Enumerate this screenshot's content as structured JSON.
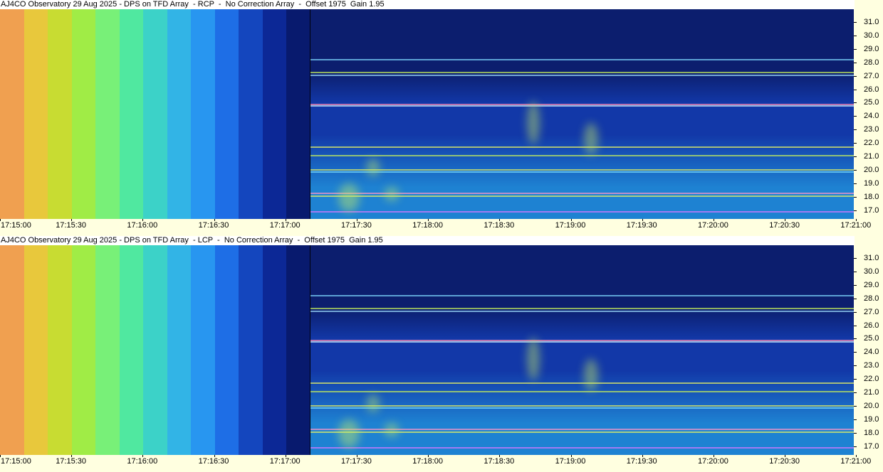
{
  "panels": [
    {
      "title": "AJ4CO Observatory 29 Aug 2025 - DPS on TFD Array  - RCP  -  No Correction Array  -  Offset 1975  Gain 1.95"
    },
    {
      "title": "AJ4CO Observatory 29 Aug 2025 - DPS on TFD Array  - LCP  -  No Correction Array  -  Offset 1975  Gain 1.95"
    }
  ],
  "frequency_axis": {
    "labels": [
      "31.0",
      "30.0",
      "29.0",
      "28.0",
      "27.0",
      "26.0",
      "25.0",
      "24.0",
      "23.0",
      "22.0",
      "21.0",
      "20.0",
      "19.0",
      "18.0",
      "17.0"
    ]
  },
  "time_axis": {
    "labels": [
      "17:15:00",
      "17:15:30",
      "17:16:00",
      "17:16:30",
      "17:17:00",
      "17:17:30",
      "17:18:00",
      "17:18:30",
      "17:19:00",
      "17:19:30",
      "17:20:00",
      "17:20:30",
      "17:21:00"
    ]
  },
  "calibration_colors": [
    "#f0a050",
    "#e8c83c",
    "#c8dc32",
    "#a0ec46",
    "#78f078",
    "#50e8a0",
    "#3cd2c8",
    "#32b4e6",
    "#2896f0",
    "#1e6ee6",
    "#1446be",
    "#0c2896",
    "#081a6e"
  ],
  "colors": {
    "background": "#ffffe0",
    "noise_base": "#1238a8",
    "noise_top": "#0c1e6e",
    "noise_bottom": "#1e82d2"
  }
}
